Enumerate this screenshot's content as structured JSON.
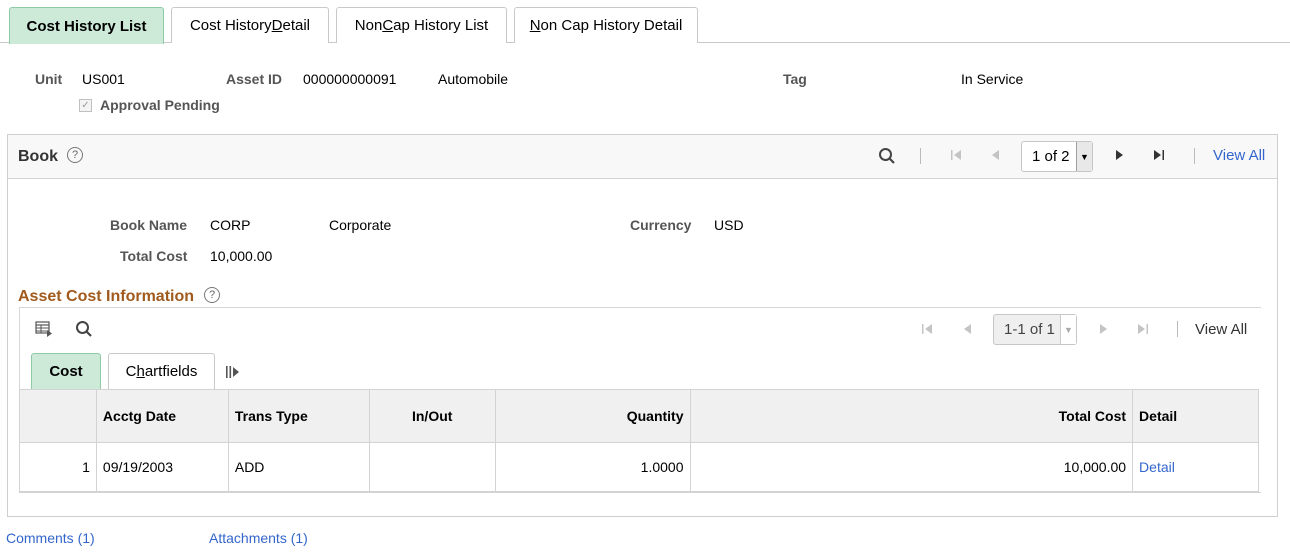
{
  "tabs": [
    {
      "label": "Cost History List",
      "active": true
    },
    {
      "label_pre": "Cost History ",
      "label_u": "D",
      "label_post": "etail"
    },
    {
      "label_pre": "Non ",
      "label_u": "C",
      "label_post": "ap History List"
    },
    {
      "label_pre": "",
      "label_u": "N",
      "label_post": "on Cap History Detail"
    }
  ],
  "header": {
    "unit_label": "Unit",
    "unit_value": "US001",
    "asset_id_label": "Asset ID",
    "asset_id_value": "000000000091",
    "asset_desc": "Automobile",
    "tag_label": "Tag",
    "tag_value": "",
    "status_value": "In Service",
    "approval_pending_label": "Approval Pending",
    "approval_pending_checked": true
  },
  "book": {
    "title": "Book",
    "nav": {
      "page_indicator": "1 of 2",
      "view_all": "View All"
    },
    "book_name_label": "Book Name",
    "book_name_value": "CORP",
    "book_desc": "Corporate",
    "currency_label": "Currency",
    "currency_value": "USD",
    "total_cost_label": "Total Cost",
    "total_cost_value": "10,000.00"
  },
  "asset_cost": {
    "title": "Asset Cost Information",
    "nav": {
      "page_indicator": "1-1 of 1",
      "view_all": "View All"
    },
    "tabs": [
      {
        "label": "Cost",
        "active": true
      },
      {
        "label_pre": "C",
        "label_u": "h",
        "label_post": "artfields"
      }
    ],
    "columns": [
      "",
      "Acctg Date",
      "Trans Type",
      "In/Out",
      "Quantity",
      "Total Cost",
      "Detail"
    ],
    "rows": [
      {
        "num": "1",
        "acctg_date": "09/19/2003",
        "trans_type": "ADD",
        "in_out": "",
        "quantity": "1.0000",
        "total_cost": "10,000.00",
        "detail": "Detail"
      }
    ]
  },
  "footer": {
    "comments": "Comments (1)",
    "attachments": "Attachments (1)"
  }
}
